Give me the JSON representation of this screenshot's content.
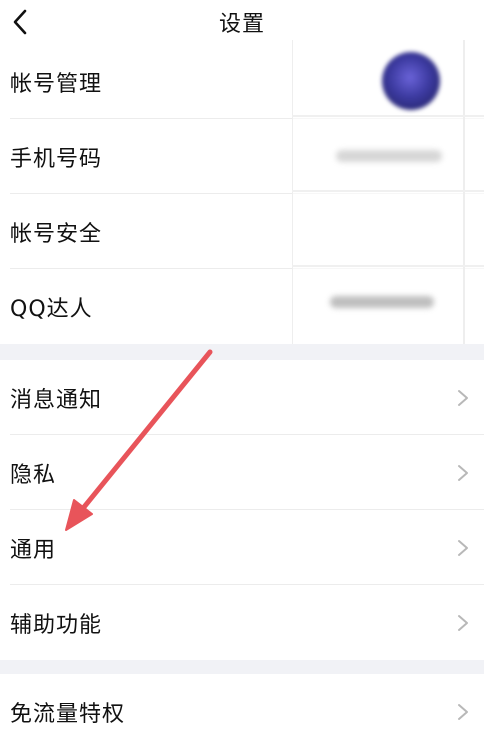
{
  "header": {
    "title": "设置",
    "back_icon": "chevron-left-icon"
  },
  "account_group": [
    {
      "label": "帐号管理",
      "name": "row-account-management"
    },
    {
      "label": "手机号码",
      "name": "row-phone-number"
    },
    {
      "label": "帐号安全",
      "name": "row-account-security"
    },
    {
      "label": "QQ达人",
      "name": "row-qq-master"
    }
  ],
  "settings_group": [
    {
      "label": "消息通知",
      "name": "row-message-notification"
    },
    {
      "label": "隐私",
      "name": "row-privacy"
    },
    {
      "label": "通用",
      "name": "row-general"
    },
    {
      "label": "辅助功能",
      "name": "row-accessibility"
    }
  ],
  "extras_group": [
    {
      "label": "免流量特权",
      "name": "row-data-free-privilege"
    }
  ],
  "annotation": {
    "color": "#e8545a",
    "target": "通用"
  }
}
